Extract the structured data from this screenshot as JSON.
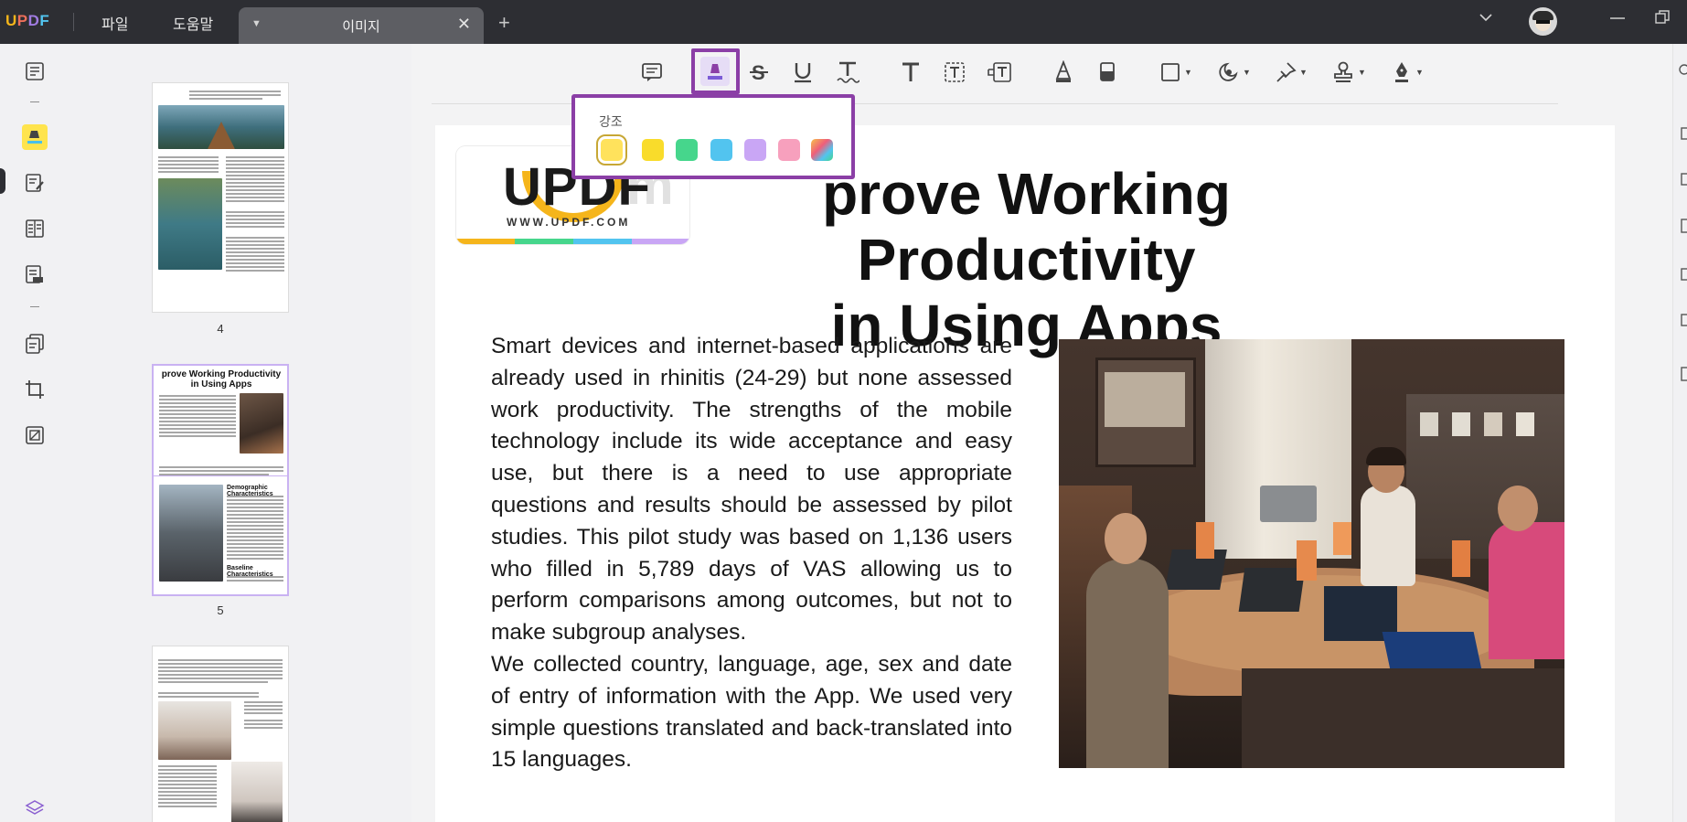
{
  "titlebar": {
    "logo": "UPDF",
    "menus": [
      "파일",
      "도움말"
    ],
    "tab_title": "이미지"
  },
  "thumbnails": {
    "pages": [
      {
        "number": "4"
      },
      {
        "number": "5",
        "title": "prove Working Productivity in Using Apps"
      },
      {
        "number": ""
      }
    ],
    "thumb5_subheads": [
      "Demographic Characteristics",
      "Baseline Characteristics"
    ]
  },
  "toolbar": {
    "selected_tool": "highlight",
    "tools": [
      "comment-icon",
      "highlight-icon",
      "strikethrough-icon",
      "underline-icon",
      "squiggly-icon",
      "text-icon",
      "textbox-icon",
      "text-callout-icon",
      "pencil-icon",
      "eraser-icon",
      "shape-icon",
      "sticker-icon",
      "pin-icon",
      "stamp-icon",
      "signature-icon"
    ]
  },
  "highlight_popup": {
    "label": "강조",
    "colors": [
      "#ffe25c",
      "#f9dc2b",
      "#46d68c",
      "#52c4ef",
      "#c9a6f5",
      "#f7a0bd",
      "gradient"
    ],
    "selected_index": 0
  },
  "document": {
    "logo_text": "UPDF",
    "logo_url": "WWW.UPDF.COM",
    "heading_line1": "prove Working Productivity",
    "heading_line2": "in Using Apps",
    "paragraph1": "Smart devices and internet-based applications are already used in rhinitis (24-29) but none assessed work productivity. The strengths of the mobile technology include its wide acceptance and easy use, but there is a need to use appropriate questions and results should be assessed by pilot studies. This pilot study was based on 1,136 users who filled in 5,789 days of VAS allowing us to perform comparisons among outcomes, but not to make subgroup analyses.",
    "paragraph2": "We collected country, language, age, sex and date of entry of information with the App. We used very simple questions translated and back-translated into 15 languages."
  },
  "colors": {
    "accent": "#8b3fa6",
    "titlebar_bg": "#2d2e33",
    "highlight_active": "#ffe44d"
  }
}
